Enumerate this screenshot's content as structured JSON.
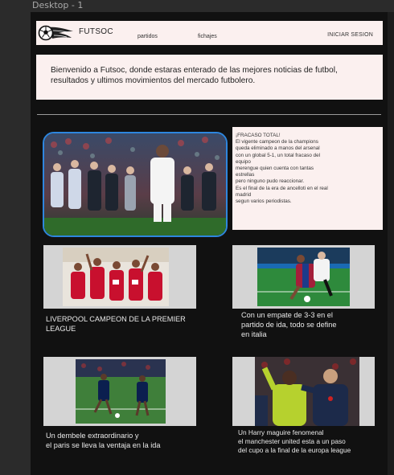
{
  "frame": {
    "label": "Desktop - 1"
  },
  "nav": {
    "brand": "FUTSOC",
    "links": [
      "partidos",
      "fichajes"
    ],
    "login": "INICIAR SESION"
  },
  "welcome": {
    "text": "Bienvenido a Futsoc, donde estaras enterado de las mejores noticias de futbol, resultados y ultimos movimientos del mercado futbolero."
  },
  "featured": {
    "lines": [
      "¡FRACASO TOTAL!",
      "El vigente campeon de la champions",
      "queda eliminado a manos del arsenal",
      "con un global 5-1, un total fracaso del",
      "equipo",
      "merengue quien cuenta con tantas",
      "estrellas",
      "pero ninguno pudo reaccionar.",
      "Es el final de la era de ancelloti en el real",
      "madrid",
      "segun varios periodistas."
    ]
  },
  "news": [
    {
      "caption_lines": [
        "LIVERPOOL CAMPEON DE LA PREMIER",
        "LEAGUE"
      ]
    },
    {
      "caption_lines": [
        "Con un empate de 3-3 en el",
        "partido de ida, todo se define",
        "en italia"
      ]
    },
    {
      "caption_lines": [
        "Un dembele extraordinario y",
        "el paris se lleva la ventaja en la ida"
      ]
    },
    {
      "caption_lines": [
        "Un Harry maguire fenomenal",
        "el manchester united esta a un paso",
        "del cupo a la final de la europa league"
      ]
    }
  ],
  "colors": {
    "background": "#111111",
    "panel": "#fbf0ef",
    "accent_border": "#2e86de",
    "card": "#d4d4d4"
  },
  "icons": {
    "logo": "soccer-ball-flame-icon"
  }
}
